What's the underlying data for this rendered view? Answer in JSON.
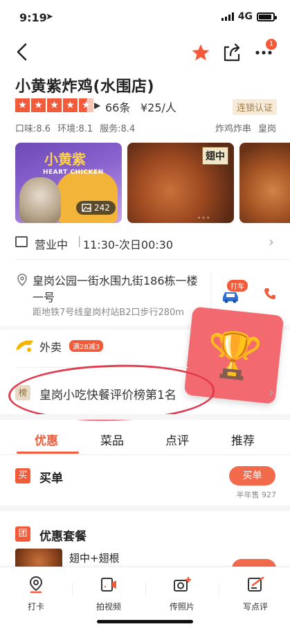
{
  "status_bar": {
    "time": "9:19",
    "network": "4G"
  },
  "header": {
    "more_badge": "1"
  },
  "shop": {
    "title": "小黄紫炸鸡(水围店)",
    "rating_stars": 4.5,
    "review_count": "66条",
    "price": "¥25/人",
    "certification": "连锁认证",
    "scores": [
      "口味:8.6",
      "环境:8.1",
      "服务:8.4"
    ],
    "tags": [
      "炸鸡炸串",
      "皇岗"
    ]
  },
  "photos": {
    "brand_text": "小黄紫",
    "brand_sub": "HEART CHICKEN",
    "count": "242",
    "tag": "翅中"
  },
  "hours": {
    "status": "营业中",
    "separator": "|",
    "time": "11:30-次日00:30"
  },
  "address": {
    "line": "皇岗公园一街水围九街186栋一楼一号",
    "distance": "距地铁7号线皇岗村站B2口步行280m",
    "taxi_label": "打车"
  },
  "takeout": {
    "label": "外卖",
    "promo": "满28减3"
  },
  "ranking": {
    "icon_text": "榜",
    "label": "皇岗小吃快餐评价榜第1名"
  },
  "tabs": [
    "优惠",
    "菜品",
    "点评",
    "推荐"
  ],
  "buy": {
    "icon_text": "买",
    "title": "买单",
    "button": "买单",
    "sold": "半年售 927"
  },
  "package": {
    "icon_text": "团",
    "title": "优惠套餐",
    "item_name": "翅中+翅根"
  },
  "bottom_bar": [
    "打卡",
    "拍视频",
    "传照片",
    "写点评"
  ],
  "colors": {
    "accent": "#f25b3a",
    "trophy_card": "#f26a6f",
    "annotation": "#e23a4f"
  }
}
